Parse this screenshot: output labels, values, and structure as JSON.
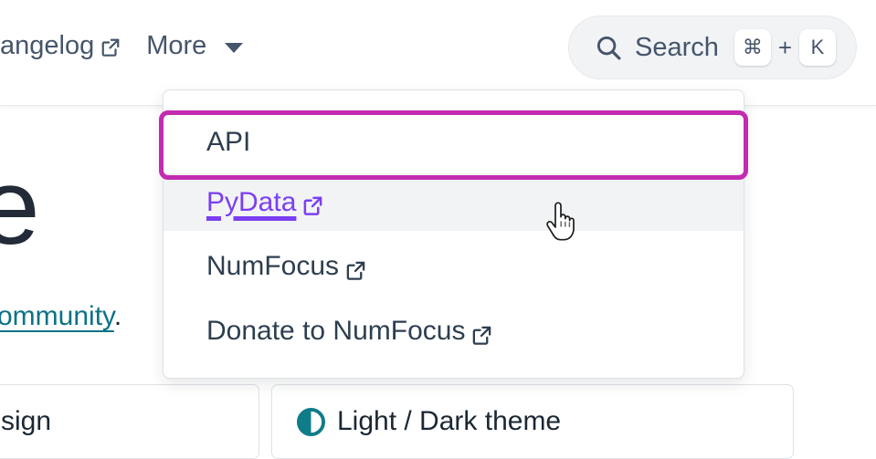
{
  "header": {
    "nav": [
      {
        "label": "angelog",
        "icon": "external-link-icon",
        "has_external": true,
        "has_caret": false
      },
      {
        "label": "More",
        "icon": "chevron-down-icon",
        "has_external": false,
        "has_caret": true
      }
    ],
    "search": {
      "icon": "search-icon",
      "label": "Search",
      "key_modifier": "⌘",
      "key_plus": "+",
      "key_letter": "K"
    }
  },
  "main": {
    "hero_glyph": "e",
    "body_text_prefix": "",
    "body_link": " community",
    "body_text_suffix": ".",
    "cards": [
      {
        "title": "sign",
        "icon": null
      },
      {
        "title": "Light / Dark theme",
        "icon": "half-circle-theme-icon"
      }
    ]
  },
  "dropdown": {
    "items": [
      {
        "label": "API",
        "external": false,
        "state": "highlighted"
      },
      {
        "label": "PyData",
        "external": true,
        "state": "hovered"
      },
      {
        "label": "NumFocus",
        "external": true,
        "state": "default"
      },
      {
        "label": "Donate to NumFocus",
        "external": true,
        "state": "default"
      }
    ]
  },
  "annotations": {
    "highlight_color": "#c32bb0",
    "hover_bg": "#f1f3f5",
    "link_purple": "#7b3ff2",
    "link_teal": "#0b7285",
    "nav_text": "#46556b",
    "theme_icon_color": "#0f7c8a"
  },
  "cursor": {
    "type": "pointer-hand-cursor"
  }
}
